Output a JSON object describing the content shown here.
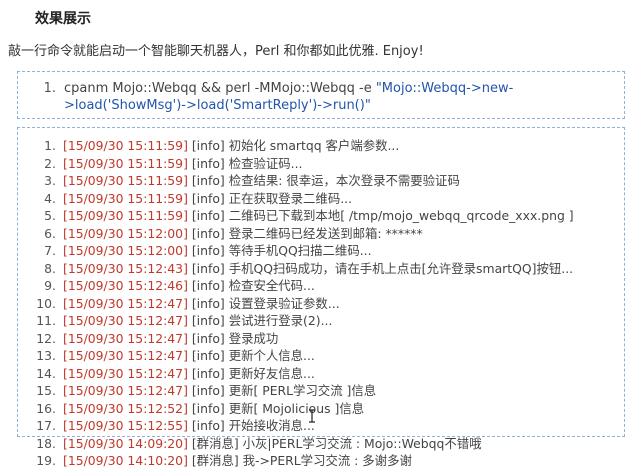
{
  "heading": "效果展示",
  "intro": "敲一行命令就能启动一个智能聊天机器人，Perl 和你都如此优雅. Enjoy!",
  "command": {
    "line_number": "1.",
    "prefix": "cpanm Mojo::Webqq && perl -MMojo::Webqq -e ",
    "string": "\"Mojo::Webqq->new->load('ShowMsg')->load('SmartReply')->run()\""
  },
  "log": [
    {
      "n": "1.",
      "ts": "[15/09/30 15:11:59]",
      "rest": " [info] 初始化 smartqq 客户端参数..."
    },
    {
      "n": "2.",
      "ts": "[15/09/30 15:11:59]",
      "rest": " [info] 检查验证码..."
    },
    {
      "n": "3.",
      "ts": "[15/09/30 15:11:59]",
      "rest": " [info] 检查结果: 很幸运，本次登录不需要验证码"
    },
    {
      "n": "4.",
      "ts": "[15/09/30 15:11:59]",
      "rest": " [info] 正在获取登录二维码..."
    },
    {
      "n": "5.",
      "ts": "[15/09/30 15:11:59]",
      "rest": " [info] 二维码已下载到本地[ /tmp/mojo_webqq_qrcode_xxx.png ]"
    },
    {
      "n": "6.",
      "ts": "[15/09/30 15:12:00]",
      "rest": " [info] 登录二维码已经发送到邮箱: ******"
    },
    {
      "n": "7.",
      "ts": "[15/09/30 15:12:00]",
      "rest": " [info] 等待手机QQ扫描二维码..."
    },
    {
      "n": "8.",
      "ts": "[15/09/30 15:12:43]",
      "rest": " [info] 手机QQ扫码成功，请在手机上点击[允许登录smartQQ]按钮..."
    },
    {
      "n": "9.",
      "ts": "[15/09/30 15:12:46]",
      "rest": " [info] 检查安全代码..."
    },
    {
      "n": "10.",
      "ts": "[15/09/30 15:12:47]",
      "rest": " [info] 设置登录验证参数..."
    },
    {
      "n": "11.",
      "ts": "[15/09/30 15:12:47]",
      "rest": " [info] 尝试进行登录(2)..."
    },
    {
      "n": "12.",
      "ts": "[15/09/30 15:12:47]",
      "rest": " [info] 登录成功"
    },
    {
      "n": "13.",
      "ts": "[15/09/30 15:12:47]",
      "rest": " [info] 更新个人信息..."
    },
    {
      "n": "14.",
      "ts": "[15/09/30 15:12:47]",
      "rest": " [info] 更新好友信息..."
    },
    {
      "n": "15.",
      "ts": "[15/09/30 15:12:47]",
      "rest": " [info] 更新[ PERL学习交流 ]信息"
    },
    {
      "n": "16.",
      "ts": "[15/09/30 15:12:52]",
      "rest": " [info] 更新[ Mojolicious ]信息"
    },
    {
      "n": "17.",
      "ts": "[15/09/30 15:12:55]",
      "rest": " [info] 开始接收消息..."
    },
    {
      "n": "18.",
      "ts": "[15/09/30 14:09:20]",
      "rest": " [群消息] 小灰|PERL学习交流 : Mojo::Webqq不错哦"
    },
    {
      "n": "19.",
      "ts": "[15/09/30 14:10:20]",
      "rest": " [群消息] 我->PERL学习交流 : 多谢多谢"
    }
  ],
  "colors": {
    "timestamp": "#c0392b",
    "string": "#2255aa",
    "border": "#8fb2d6"
  },
  "icons": {
    "cursor": "text-cursor-icon"
  }
}
